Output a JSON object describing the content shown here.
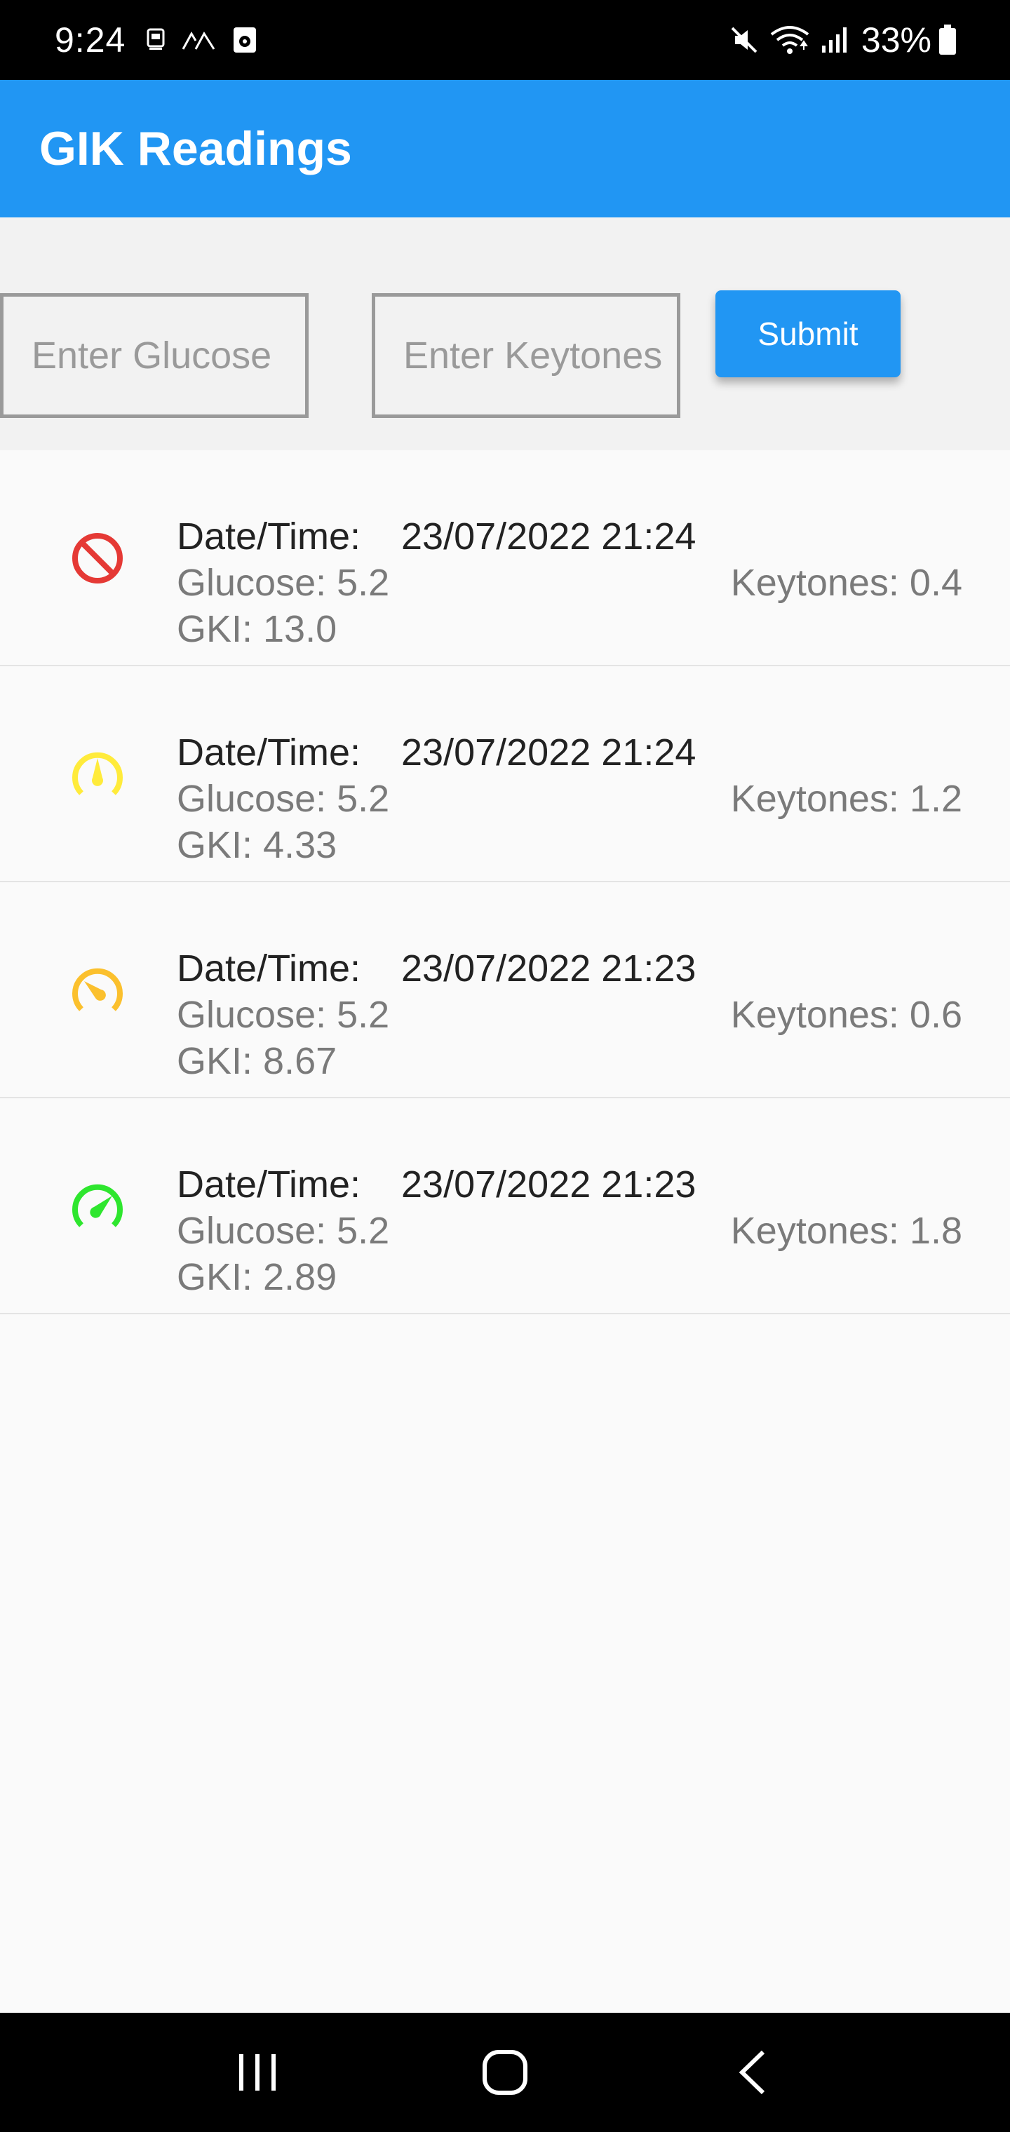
{
  "status_bar": {
    "time": "9:24",
    "battery": "33%",
    "icons_left": [
      "notification-icon",
      "wave-icon",
      "media-icon"
    ],
    "icons_right": [
      "mute-icon",
      "wifi-icon",
      "signal-icon",
      "battery-icon"
    ]
  },
  "app_bar": {
    "title": "GIK Readings",
    "color": "#2196f3"
  },
  "form": {
    "glucose_placeholder": "Enter Glucose",
    "keytones_placeholder": "Enter Keytones",
    "submit_label": "Submit"
  },
  "readings": [
    {
      "datetime_label": "Date/Time:",
      "datetime": "23/07/2022 21:24",
      "glucose": "Glucose: 5.2",
      "gki": "GKI: 13.0",
      "keytones": "Keytones: 0.4",
      "icon": "no-entry-icon",
      "icon_color": "#e53935"
    },
    {
      "datetime_label": "Date/Time:",
      "datetime": "23/07/2022 21:24",
      "glucose": "Glucose: 5.2",
      "gki": "GKI: 4.33",
      "keytones": "Keytones: 1.2",
      "icon": "gauge-mid-icon",
      "icon_color": "#ffeb3b"
    },
    {
      "datetime_label": "Date/Time:",
      "datetime": "23/07/2022 21:23",
      "glucose": "Glucose: 5.2",
      "gki": "GKI: 8.67",
      "keytones": "Keytones: 0.6",
      "icon": "gauge-low-icon",
      "icon_color": "#fbc02d"
    },
    {
      "datetime_label": "Date/Time:",
      "datetime": "23/07/2022 21:23",
      "glucose": "Glucose: 5.2",
      "gki": "GKI: 2.89",
      "keytones": "Keytones: 1.8",
      "icon": "gauge-high-icon",
      "icon_color": "#2ee62e"
    }
  ],
  "nav_bar": {
    "buttons": [
      "recent-apps-icon",
      "home-icon",
      "back-icon"
    ]
  }
}
